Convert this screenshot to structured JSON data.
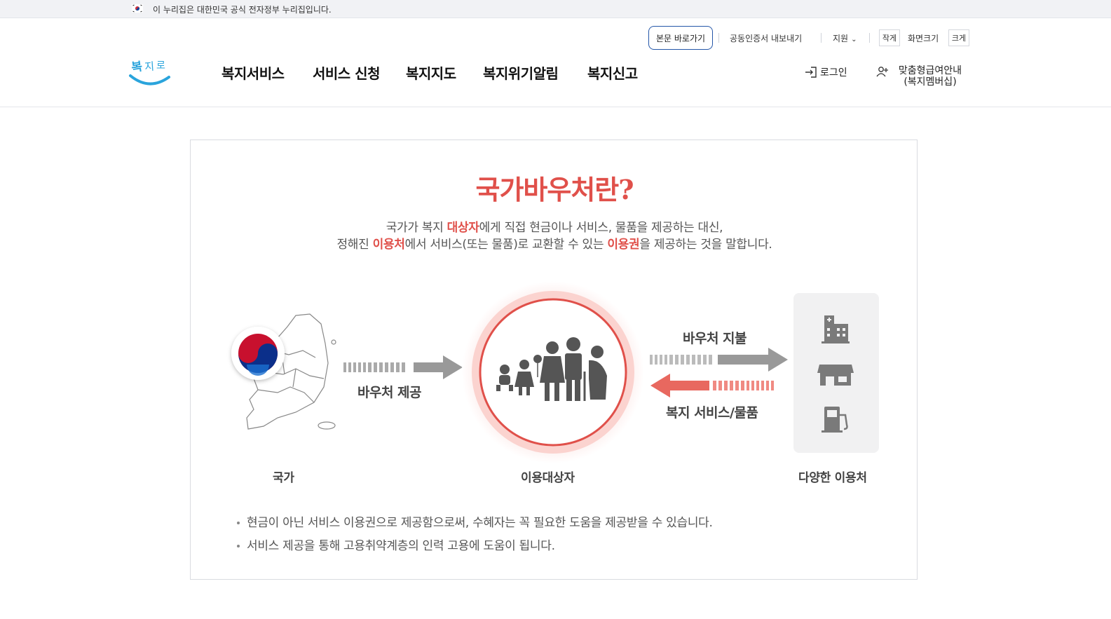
{
  "gov_banner": {
    "text": "이 누리집은 대한민국 공식 전자정부 누리집입니다."
  },
  "util_nav": {
    "skip_label": "본문 바로가기",
    "cert_export": "공동인증서 내보내기",
    "support": "지원",
    "size_small": "작게",
    "size_label": "화면크기",
    "size_large": "크게"
  },
  "header": {
    "logo_text": "복지로",
    "gnb": [
      "복지서비스",
      "서비스 신청",
      "복지지도",
      "복지위기알림",
      "복지신고"
    ],
    "login": "로그인",
    "member_line1": "맞춤형급여안내",
    "member_line2": "(복지멤버십)"
  },
  "content": {
    "title": "국가바우처란?",
    "desc_line1": {
      "pre": "국가가 복지 ",
      "hl1": "대상자",
      "post": "에게 직접 현금이나 서비스, 물품을 제공하는 대신,"
    },
    "desc_line2": {
      "pre": "정해진 ",
      "hl1": "이용처",
      "mid": "에서 서비스(또는 물품)로 교환할 수 있는 ",
      "hl2": "이용권",
      "post": "을 제공하는 것을 말합니다."
    },
    "arrows": {
      "voucher_provide": "바우처 제공",
      "voucher_pay": "바우처 지불",
      "welfare_goods": "복지 서비스/물품"
    },
    "captions": {
      "nation": "국가",
      "recipient": "이용대상자",
      "providers": "다양한 이용처"
    },
    "notes": [
      "현금이 아닌 서비스 이용권으로 제공함으로써, 수혜자는 꼭 필요한 도움을 제공받을 수 있습니다.",
      "서비스 제공을 통해 고용취약계층의 인력 고용에 도움이 됩니다."
    ]
  },
  "colors": {
    "accent_red": "#e0504a",
    "nav_blue": "#2456a8",
    "logo_blue": "#2aa4dc"
  }
}
